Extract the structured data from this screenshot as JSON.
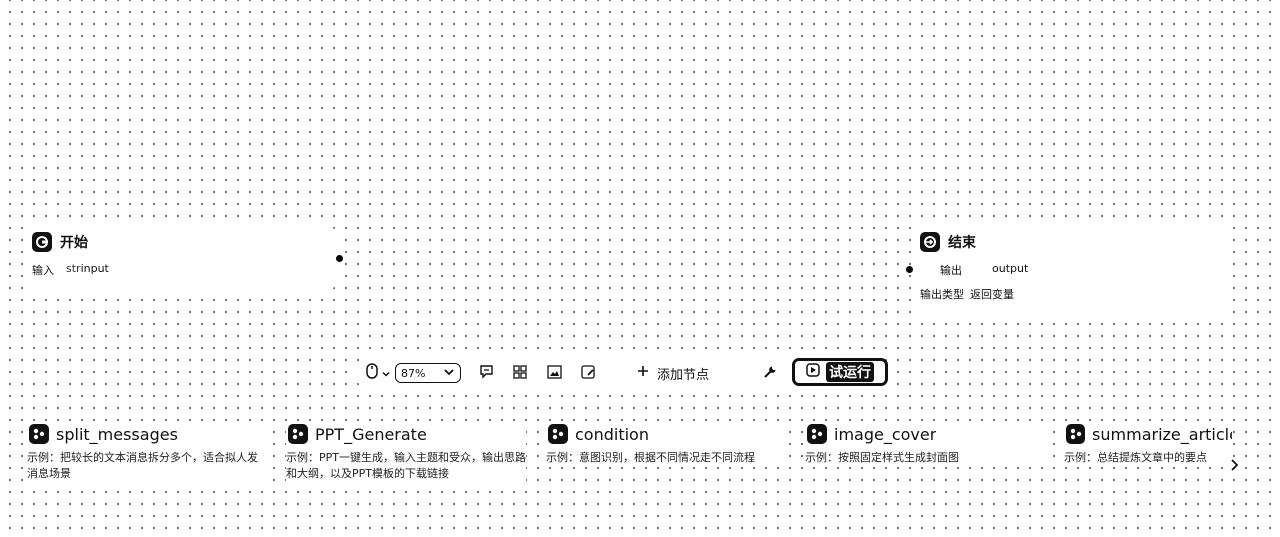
{
  "start_node": {
    "title": "开始",
    "input_label": "输入",
    "input_type": "str",
    "input_name": "input"
  },
  "end_node": {
    "title": "结束",
    "output_label": "输出",
    "output_name": "output",
    "output_type_label": "输出类型",
    "output_type_value": "返回变量"
  },
  "toolbar": {
    "zoom_value": "87%",
    "add_node_label": "添加节点",
    "run_label": "试运行"
  },
  "templates": [
    {
      "title": "split_messages",
      "desc": "示例：把较长的文本消息拆分多个，适合拟人发消息场景"
    },
    {
      "title": "PPT_Generate",
      "desc": "示例：PPT一键生成，输入主题和受众，输出思路和大纲，以及PPT模板的下载链接"
    },
    {
      "title": "condition",
      "desc": "示例：意图识别，根据不同情况走不同流程"
    },
    {
      "title": "image_cover",
      "desc": "示例：按照固定样式生成封面图"
    },
    {
      "title": "summarize_article",
      "desc": "示例：总结提炼文章中的要点"
    }
  ]
}
